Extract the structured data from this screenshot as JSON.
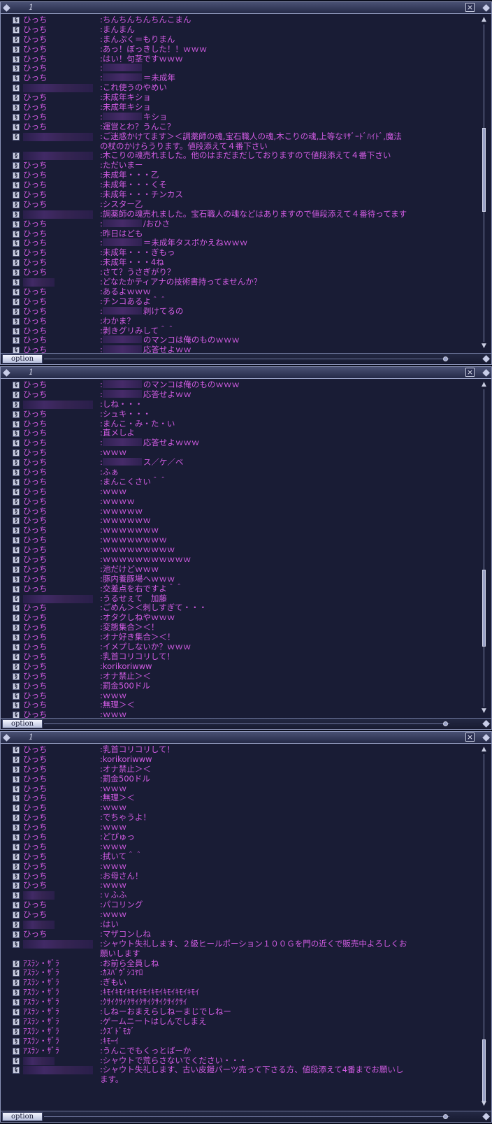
{
  "windows": [
    {
      "number": "1",
      "close_label": "×",
      "option_label": "option",
      "rows": [
        {
          "sender": "ひっち",
          "message": ":ちんちんちんちんこまん"
        },
        {
          "sender": "ひっち",
          "message": ":まんまん"
        },
        {
          "sender": "ひっち",
          "message": ":まんぷく＝もりまん"
        },
        {
          "sender": "ひっち",
          "message": ":あっ！ぼっきした！！ｗｗｗ"
        },
        {
          "sender": "ひっち",
          "message": ":はい！句茎ですｗｗｗ"
        },
        {
          "sender": "ひっち",
          "message": ":",
          "redacted_msg": true
        },
        {
          "sender": "ひっち",
          "message": ":",
          "redacted_msg": true,
          "tail": "＝未成年"
        },
        {
          "sender": "",
          "redacted_name": true,
          "message": ":これ使うのやめい"
        },
        {
          "sender": "ひっち",
          "message": ":未成年キショ"
        },
        {
          "sender": "ひっち",
          "message": ":未成年キショ"
        },
        {
          "sender": "ひっち",
          "message": ":",
          "redacted_msg": true,
          "tail": "キショ"
        },
        {
          "sender": "ひっち",
          "message": ":運営とわ？うんこ？"
        },
        {
          "sender": "",
          "redacted_name": true,
          "message": ":ご迷惑かけてます＞＜調薬師の魂,宝石職人の魂,木こりの魂,上等なﾘｻﾞｰﾄﾞﾊｲﾄﾞ,魔法"
        },
        {
          "sender": "",
          "message": " の杖のかけらうります。値段添えて４番下さい"
        },
        {
          "sender": "",
          "redacted_name": true,
          "message": ":木こりの魂売れました。他のはまだまだしておりますので値段添えて４番下さい"
        },
        {
          "sender": "ひっち",
          "message": ":ただいまー"
        },
        {
          "sender": "ひっち",
          "message": ":未成年・・・乙"
        },
        {
          "sender": "ひっち",
          "message": ":未成年・・・くそ"
        },
        {
          "sender": "ひっち",
          "message": ":未成年・・・チンカス"
        },
        {
          "sender": "ひっち",
          "message": ":シスター乙"
        },
        {
          "sender": "",
          "redacted_name": true,
          "message": ":調薬師の魂売れました。宝石職人の魂などはありますので値段添えて４番待ってます"
        },
        {
          "sender": "ひっち",
          "message": ":",
          "redacted_msg": true,
          "tail": "/おひさ"
        },
        {
          "sender": "ひっち",
          "message": ":昨日はども"
        },
        {
          "sender": "ひっち",
          "message": ":",
          "redacted_msg": true,
          "tail": "＝未成年タスボかえねｗｗｗ"
        },
        {
          "sender": "ひっち",
          "message": ":未成年・・・ぎもっ"
        },
        {
          "sender": "ひっち",
          "message": ":未成年・・・4ね"
        },
        {
          "sender": "ひっち",
          "message": ":さて？うさぎがり？"
        },
        {
          "sender": "",
          "redacted_name": true,
          "short": true,
          "message": ":どなたかティアナの技術書持ってませんか？"
        },
        {
          "sender": "ひっち",
          "message": ":あるよｗｗｗ"
        },
        {
          "sender": "ひっち",
          "message": ":チンコあるよ＾＾"
        },
        {
          "sender": "ひっち",
          "message": ":",
          "redacted_msg": true,
          "tail": "剥けてるの"
        },
        {
          "sender": "ひっち",
          "message": ":わかま？"
        },
        {
          "sender": "ひっち",
          "message": ":剥きグリみして＾＾"
        },
        {
          "sender": "ひっち",
          "message": ":",
          "redacted_msg": true,
          "tail": "のマンコは俺のものｗｗｗ"
        },
        {
          "sender": "ひっち",
          "message": ":",
          "redacted_msg": true,
          "tail": "応答せよｗｗ"
        }
      ]
    },
    {
      "number": "1",
      "close_label": "×",
      "option_label": "option",
      "rows": [
        {
          "sender": "ひっち",
          "message": ":",
          "redacted_msg": true,
          "tail": "のマンコは俺のものｗｗｗ"
        },
        {
          "sender": "ひっち",
          "message": ":",
          "redacted_msg": true,
          "tail": "応答せよｗｗ"
        },
        {
          "sender": "",
          "redacted_name": true,
          "message": ":しね・・・"
        },
        {
          "sender": "ひっち",
          "message": ":シュキ・・・"
        },
        {
          "sender": "ひっち",
          "message": ":まんこ・み・た・い"
        },
        {
          "sender": "ひっち",
          "message": ":直メしよ"
        },
        {
          "sender": "ひっち",
          "message": ":",
          "redacted_msg": true,
          "tail": "応答せよｗｗｗ"
        },
        {
          "sender": "ひっち",
          "message": ":ｗｗｗ"
        },
        {
          "sender": "ひっち",
          "message": ":",
          "redacted_msg": true,
          "tail": "ス／ケ／ベ"
        },
        {
          "sender": "ひっち",
          "message": ":ふぁ"
        },
        {
          "sender": "ひっち",
          "message": ":まんこくさい＾＾"
        },
        {
          "sender": "ひっち",
          "message": ":ｗｗｗ"
        },
        {
          "sender": "ひっち",
          "message": ":ｗｗｗｗ"
        },
        {
          "sender": "ひっち",
          "message": ":ｗｗｗｗｗ"
        },
        {
          "sender": "ひっち",
          "message": ":ｗｗｗｗｗｗ"
        },
        {
          "sender": "ひっち",
          "message": ":ｗｗｗｗｗｗｗ"
        },
        {
          "sender": "ひっち",
          "message": ":ｗｗｗｗｗｗｗｗ"
        },
        {
          "sender": "ひっち",
          "message": ":ｗｗｗｗｗｗｗｗｗ"
        },
        {
          "sender": "ひっち",
          "message": ":ｗｗｗｗｗｗｗｗｗｗｗ"
        },
        {
          "sender": "ひっち",
          "message": ":池だけどｗｗｗ"
        },
        {
          "sender": "ひっち",
          "message": ":豚内養豚場へｗｗｗ"
        },
        {
          "sender": "ひっち",
          "message": ":交差点を右ですよ＾＾"
        },
        {
          "sender": "",
          "redacted_name": true,
          "message": ":うるせぇて　加藤"
        },
        {
          "sender": "ひっち",
          "message": ":ごめん＞＜刺しすぎて・・・"
        },
        {
          "sender": "ひっち",
          "message": ":オタクしねやｗｗｗ"
        },
        {
          "sender": "ひっち",
          "message": ":変態集合＞＜！"
        },
        {
          "sender": "ひっち",
          "message": ":オナ好き集合＞＜！"
        },
        {
          "sender": "ひっち",
          "message": ":イメプしないか？ｗｗｗ"
        },
        {
          "sender": "ひっち",
          "message": ":乳首コリコリして！"
        },
        {
          "sender": "ひっち",
          "message": ":korikoriwww"
        },
        {
          "sender": "ひっち",
          "message": ":オナ禁止＞＜"
        },
        {
          "sender": "ひっち",
          "message": ":罰金500ドル"
        },
        {
          "sender": "ひっち",
          "message": ":ｗｗｗ"
        },
        {
          "sender": "ひっち",
          "message": ":無理＞＜"
        },
        {
          "sender": "ひっち",
          "message": ":ｗｗｗ"
        }
      ]
    },
    {
      "number": "1",
      "close_label": "×",
      "option_label": "option",
      "rows": [
        {
          "sender": "ひっち",
          "message": ":乳首コリコリして！"
        },
        {
          "sender": "ひっち",
          "message": ":korikoriwww"
        },
        {
          "sender": "ひっち",
          "message": ":オナ禁止＞＜"
        },
        {
          "sender": "ひっち",
          "message": ":罰金500ドル"
        },
        {
          "sender": "ひっち",
          "message": ":ｗｗｗ"
        },
        {
          "sender": "ひっち",
          "message": ":無理＞＜"
        },
        {
          "sender": "ひっち",
          "message": ":ｗｗｗ"
        },
        {
          "sender": "ひっち",
          "message": ":でちゃうよ！"
        },
        {
          "sender": "ひっち",
          "message": ":ｗｗｗ"
        },
        {
          "sender": "ひっち",
          "message": ":どぴゅっ"
        },
        {
          "sender": "ひっち",
          "message": ":ｗｗｗ"
        },
        {
          "sender": "ひっち",
          "message": ":拭いて＾＾"
        },
        {
          "sender": "ひっち",
          "message": ":ｗｗｗ"
        },
        {
          "sender": "ひっち",
          "message": ":お母さん！"
        },
        {
          "sender": "ひっち",
          "message": ":ｗｗｗ"
        },
        {
          "sender": "",
          "redacted_name": true,
          "short": true,
          "message": ":ｖふふ"
        },
        {
          "sender": "ひっち",
          "message": ":パコリング"
        },
        {
          "sender": "ひっち",
          "message": ":ｗｗｗ"
        },
        {
          "sender": "",
          "redacted_name": true,
          "short": true,
          "message": ":はい"
        },
        {
          "sender": "ひっち",
          "message": ":マザコンしね"
        },
        {
          "sender": "",
          "redacted_name": true,
          "message": ":シャウト失礼します、２級ヒールポーション１００Ｇを門の近くで販売中よろしくお"
        },
        {
          "sender": "",
          "message": " 願いします"
        },
        {
          "sender": "ｱｽﾗﾝ・ｻﾞﾗ",
          "message": ":お前ら全員しね"
        },
        {
          "sender": "ｱｽﾗﾝ・ｻﾞﾗ",
          "message": ":ｶｽﾊﾞｳﾞｼｺﾔﾛ"
        },
        {
          "sender": "ｱｽﾗﾝ・ｻﾞﾗ",
          "message": ":ぎもい"
        },
        {
          "sender": "ｱｽﾗﾝ・ｻﾞﾗ",
          "message": ":ｷﾓｲｷﾓｲｷﾓｲｷﾓｲｷﾓｲｷﾓｲｷﾓｲｷﾓｲ"
        },
        {
          "sender": "ｱｽﾗﾝ・ｻﾞﾗ",
          "message": ":ｸｻｲｸｻｲｸｻｲｸｻｲｸｻｲｸｻｲｸｻｲ"
        },
        {
          "sender": "ｱｽﾗﾝ・ｻﾞﾗ",
          "message": ":しねーおまえらしねーまじでしねー"
        },
        {
          "sender": "ｱｽﾗﾝ・ｻﾞﾗ",
          "message": ":ゲームニートはしんでしまえ"
        },
        {
          "sender": "ｱｽﾗﾝ・ｻﾞﾗ",
          "message": ":ｸｽﾞﾄﾞﾓｶﾞ"
        },
        {
          "sender": "ｱｽﾗﾝ・ｻﾞﾗ",
          "message": ":ｷﾓｰｲ"
        },
        {
          "sender": "ｱｽﾗﾝ・ｻﾞﾗ",
          "message": ":うんこでもくっとばーか"
        },
        {
          "sender": "",
          "redacted_name": true,
          "short": true,
          "message": ":シャウトで荒らさないでください・・・"
        },
        {
          "sender": "",
          "redacted_name": true,
          "message": ":シャウト失礼します、古い皮鎧パーツ売って下さる方、値段添えて4番までお願いし"
        },
        {
          "sender": "",
          "message": " ます。"
        }
      ]
    }
  ]
}
